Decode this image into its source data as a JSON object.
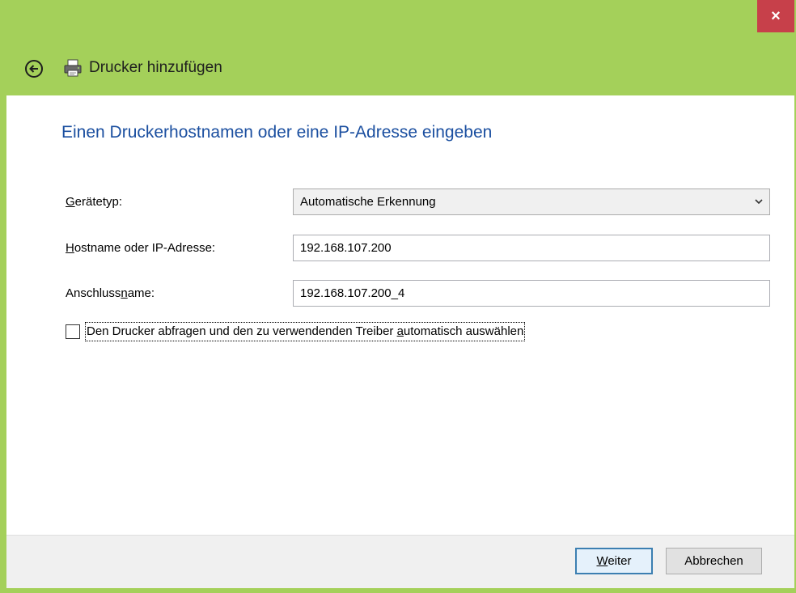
{
  "window": {
    "close_label": "×"
  },
  "header": {
    "title": "Drucker hinzufügen"
  },
  "main": {
    "heading": "Einen Druckerhostnamen oder eine IP-Adresse eingeben",
    "device_type": {
      "label_pre": "",
      "label_u": "G",
      "label_post": "erätetyp:",
      "value": "Automatische Erkennung"
    },
    "hostname": {
      "label_pre": "",
      "label_u": "H",
      "label_post": "ostname oder IP-Adresse:",
      "value": "192.168.107.200"
    },
    "port_name": {
      "label_pre": "Anschluss",
      "label_u": "n",
      "label_post": "ame:",
      "value": "192.168.107.200_4"
    },
    "auto_driver": {
      "label_pre": "Den Drucker abfragen und den zu verwendenden Treiber ",
      "label_u": "a",
      "label_post": "utomatisch auswählen",
      "checked": false
    }
  },
  "footer": {
    "next_u": "W",
    "next_post": "eiter",
    "cancel_label": "Abbrechen"
  },
  "colors": {
    "window_frame": "#a4d05a",
    "close_button": "#c7404a",
    "heading": "#1b4fa0",
    "primary_button_border": "#3c7fb1"
  }
}
